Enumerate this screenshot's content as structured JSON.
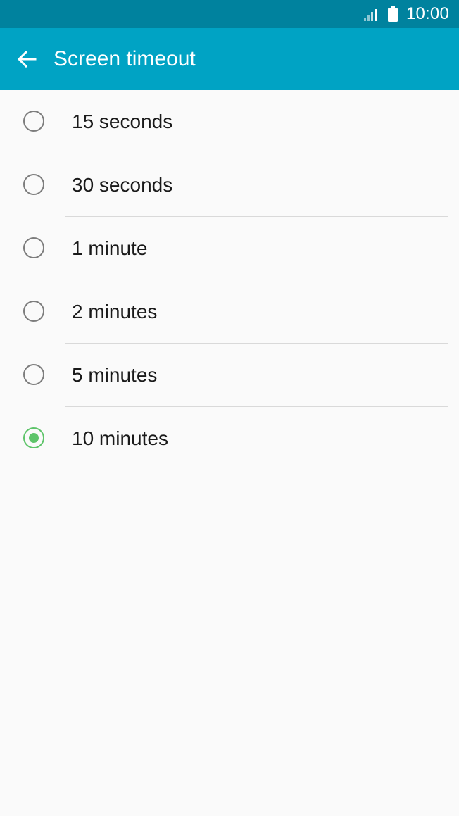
{
  "status_bar": {
    "time": "10:00",
    "signal_icon": "signal-icon",
    "battery_icon": "battery-icon"
  },
  "app_bar": {
    "back_icon": "arrow-left-icon",
    "title": "Screen timeout"
  },
  "options": [
    {
      "label": "15 seconds",
      "checked": false
    },
    {
      "label": "30 seconds",
      "checked": false
    },
    {
      "label": "1 minute",
      "checked": false
    },
    {
      "label": "2 minutes",
      "checked": false
    },
    {
      "label": "5 minutes",
      "checked": false
    },
    {
      "label": "10 minutes",
      "checked": true
    }
  ],
  "colors": {
    "status_bar": "#00829e",
    "app_bar": "#00a3c4",
    "accent": "#5ec46a",
    "background": "#fafafa"
  }
}
